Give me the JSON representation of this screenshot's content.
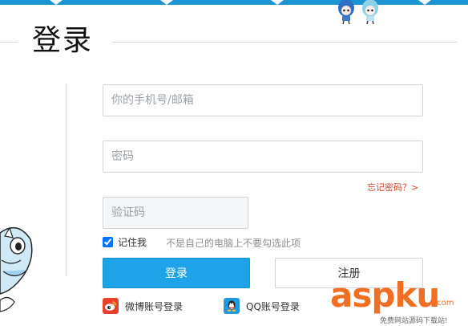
{
  "colors": {
    "accent": "#1b95d4",
    "login_button": "#1fa3e8",
    "forgot_link": "#d9462b",
    "watermark": "#f06f22",
    "weibo": "#e8402a",
    "qq": "#1f9ae0"
  },
  "page": {
    "title": "登录"
  },
  "form": {
    "account_placeholder": "你的手机号/邮箱",
    "account_value": "",
    "password_placeholder": "密码",
    "password_value": "",
    "captcha_placeholder": "验证码",
    "captcha_value": "",
    "forgot_label": "忘记密码？>",
    "remember_label": "记住我",
    "remember_checked": true,
    "remember_hint": "不是自己的电脑上不要勾选此项",
    "login_label": "登录",
    "register_label": "注册"
  },
  "social": {
    "weibo_label": "微博账号登录",
    "weibo_icon": "weibo-icon",
    "qq_label": "QQ账号登录",
    "qq_icon": "qq-icon"
  },
  "watermark": {
    "text": "aspku",
    "suffix": ".com",
    "subtext": "免费网站源码下载站!"
  }
}
